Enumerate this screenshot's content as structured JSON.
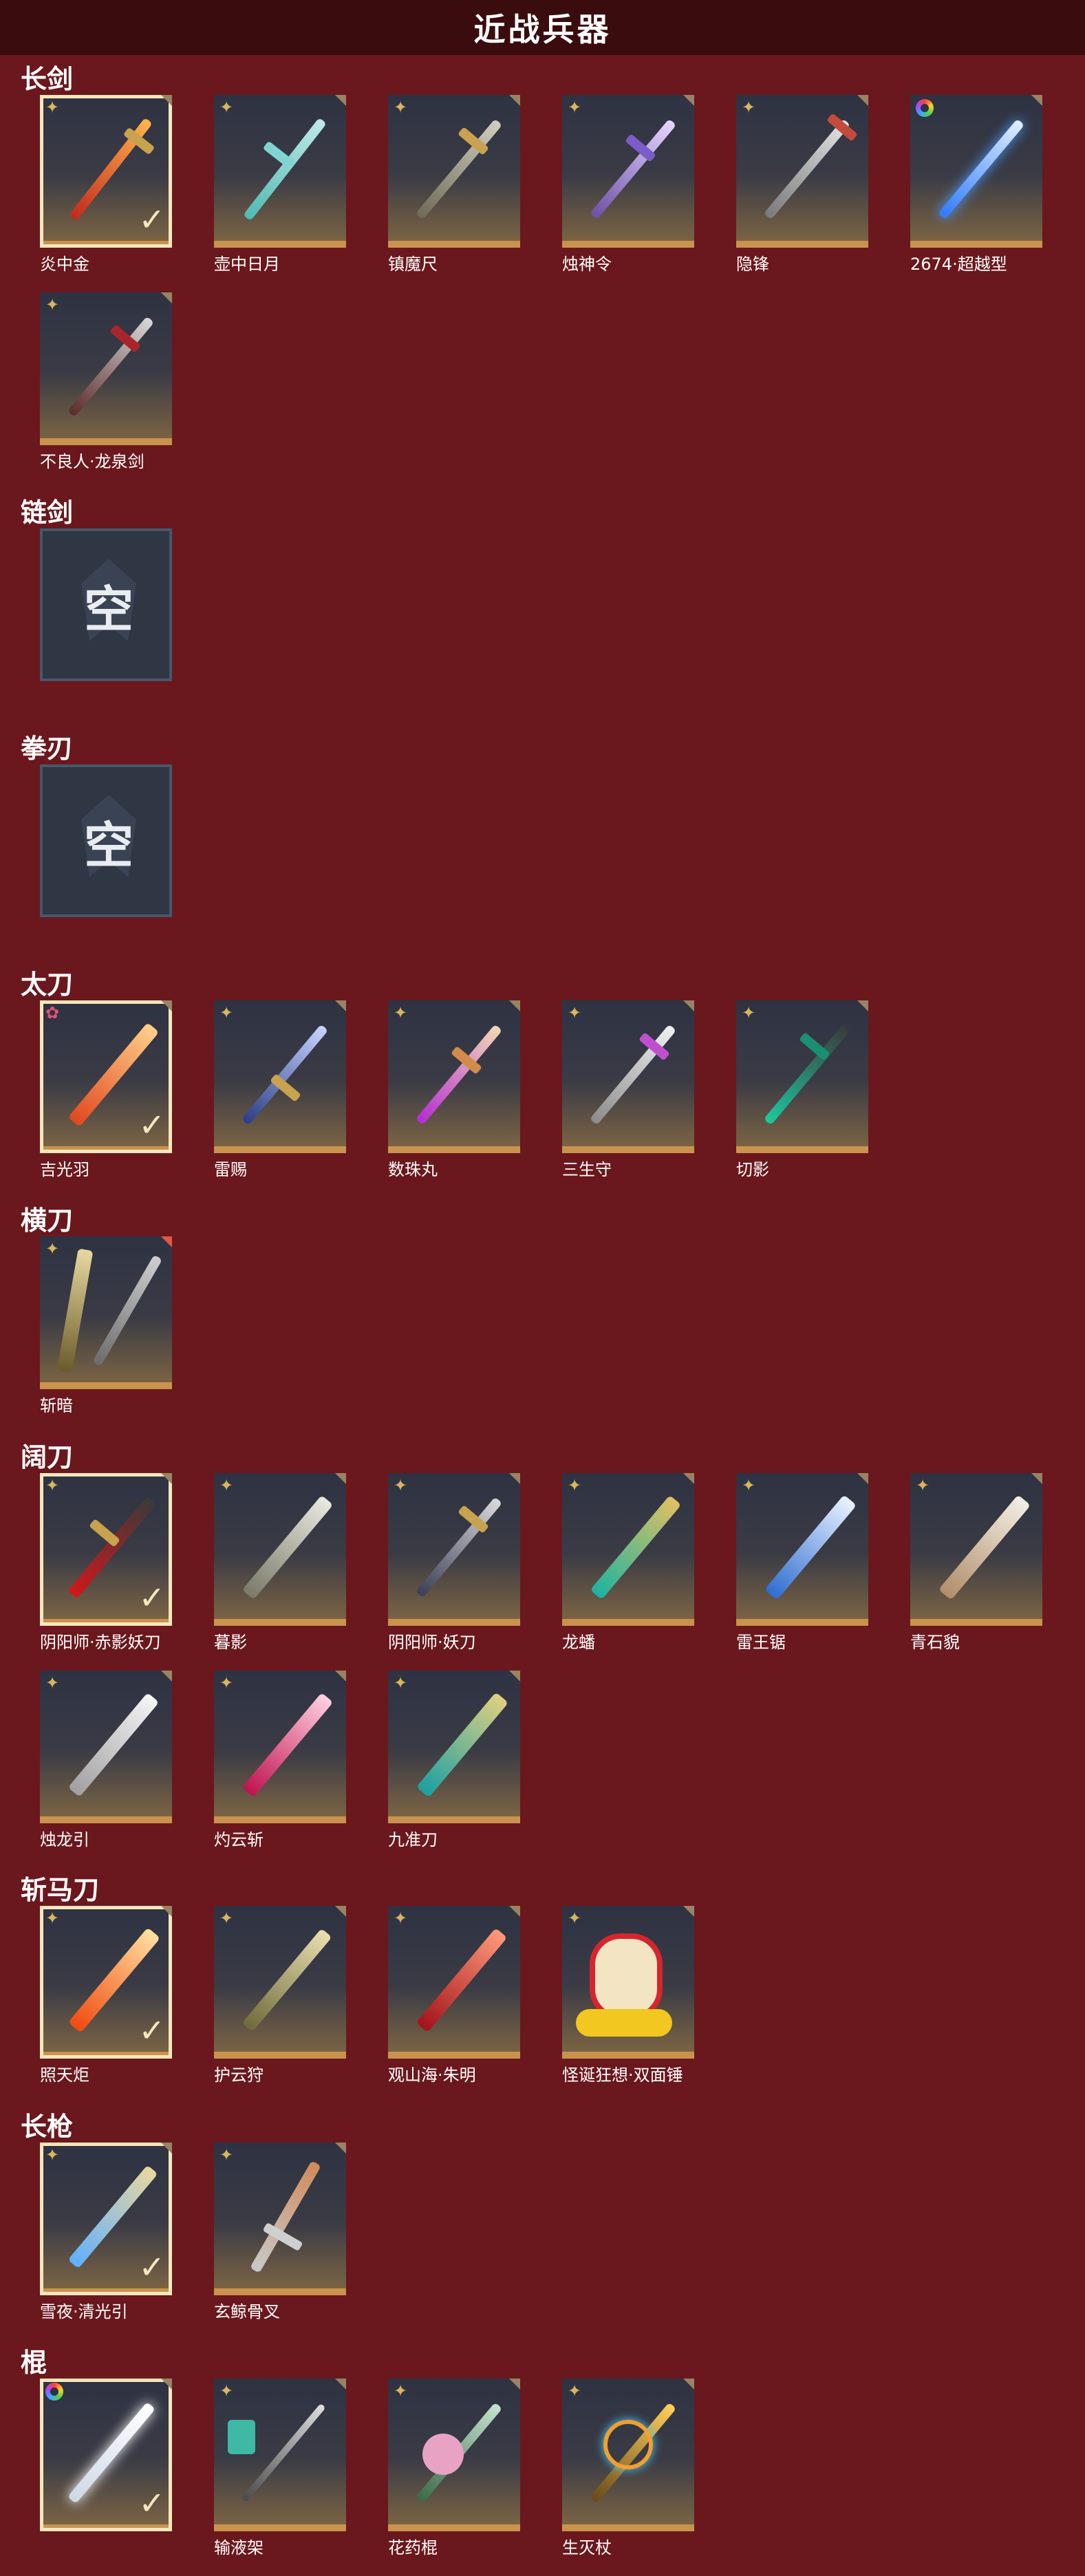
{
  "header": {
    "title": "近战兵器"
  },
  "sections": [
    {
      "title": "长剑",
      "items": [
        "炎中金",
        "壶中日月",
        "镇魔尺",
        "烛神令",
        "隐锋",
        "2674·超越型",
        "不良人·龙泉剑"
      ]
    },
    {
      "title": "链剑",
      "items": [],
      "empty_label": "空"
    },
    {
      "title": "拳刃",
      "items": [],
      "empty_label": "空"
    },
    {
      "title": "太刀",
      "items": [
        "吉光羽",
        "雷赐",
        "数珠丸",
        "三生守",
        "切影"
      ]
    },
    {
      "title": "横刀",
      "items": [
        "斩暗"
      ]
    },
    {
      "title": "阔刀",
      "items": [
        "阴阳师·赤影妖刀",
        "暮影",
        "阴阳师·妖刀",
        "龙蟠",
        "雷王锯",
        "青石貌",
        "烛龙引",
        "灼云斩",
        "九准刀"
      ]
    },
    {
      "title": "斩马刀",
      "items": [
        "照天炬",
        "护云狩",
        "观山海·朱明",
        "怪诞狂想·双面锤"
      ]
    },
    {
      "title": "长枪",
      "items": [
        "雪夜·清光引",
        "玄鲸骨叉"
      ]
    },
    {
      "title": "棍",
      "items": [
        "",
        "输液架",
        "花药棍",
        "生灭杖"
      ]
    }
  ],
  "colors": {
    "background": "#6a181d",
    "header": "#3a0c0e",
    "card_border_gold": "#c9934e",
    "selected_outline": "#f6e7bc",
    "rank_gold": "#d7b65c"
  },
  "icons": {
    "rank": "star-icon",
    "selected": "checkmark-icon"
  }
}
